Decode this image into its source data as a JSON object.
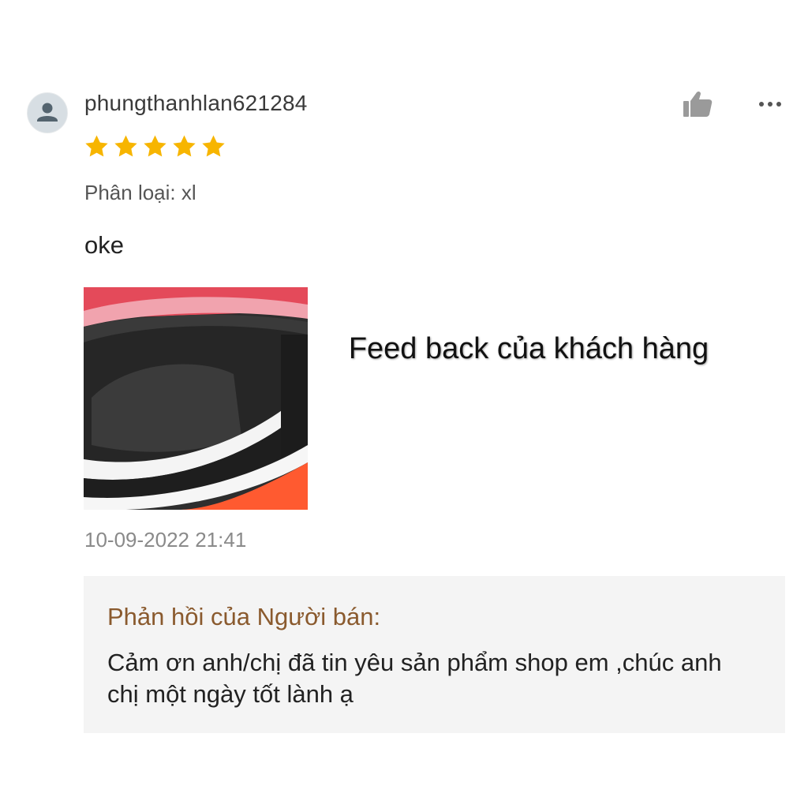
{
  "review": {
    "username": "phungthanhlan621284",
    "rating": 5,
    "variation_text": "Phân loại: xl",
    "comment": "oke",
    "overlay_caption": "Feed back của khách hàng",
    "timestamp": "10-09-2022 21:41"
  },
  "seller_reply": {
    "title": "Phản hồi của Người bán:",
    "body": "Cảm ơn anh/chị đã tin yêu sản phẩm shop em ,chúc anh chị một ngày tốt lành ạ"
  },
  "icons": {
    "avatar": "user-avatar-icon",
    "like": "thumbs-up-icon",
    "more": "more-options-icon",
    "star": "star-icon"
  },
  "colors": {
    "star": "#f7b500",
    "reply_title": "#8a5a2e",
    "reply_background": "#f4f4f4",
    "icon_gray": "#9a9a9a"
  }
}
